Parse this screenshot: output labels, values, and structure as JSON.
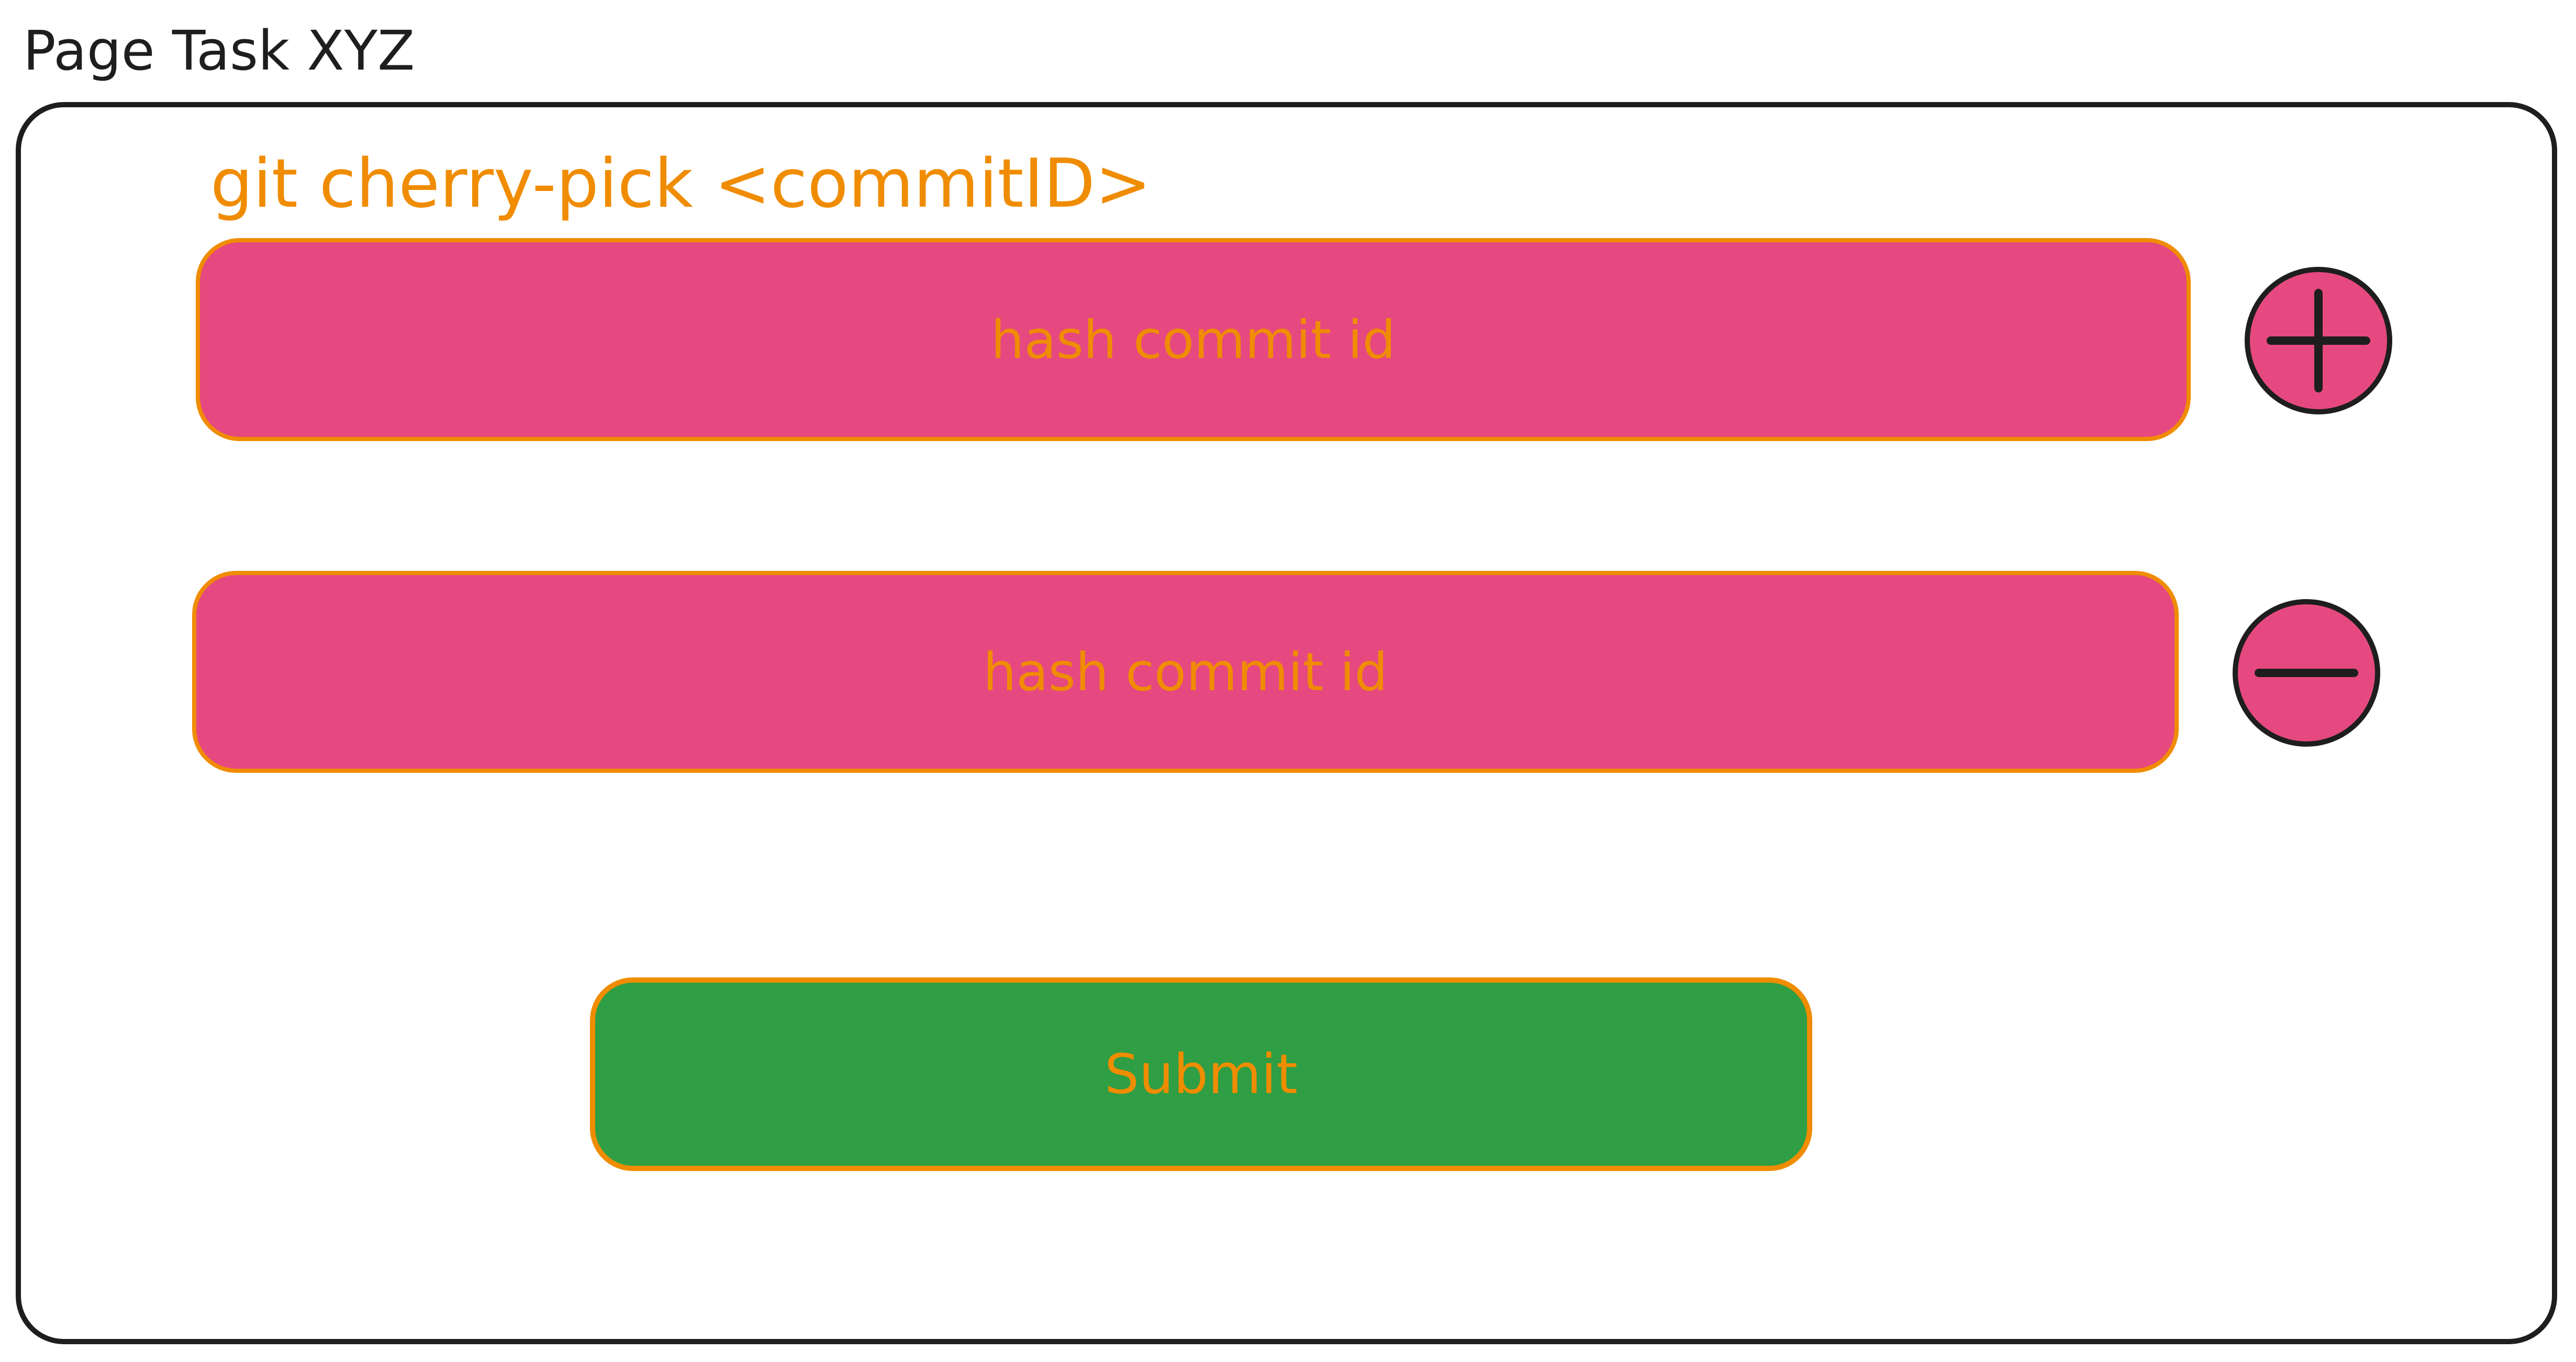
{
  "page": {
    "title": "Page Task XYZ"
  },
  "form": {
    "command_label": "git cherry-pick <commitID>",
    "inputs": [
      {
        "placeholder": "hash commit id",
        "value": ""
      },
      {
        "placeholder": "hash commit id",
        "value": ""
      }
    ],
    "add_icon": "plus-circle-icon",
    "remove_icon": "minus-circle-icon",
    "submit_label": "Submit"
  },
  "colors": {
    "accent_text": "#f08c00",
    "input_fill": "#e64980",
    "submit_fill": "#2f9e44",
    "outline": "#1e1e1e"
  }
}
